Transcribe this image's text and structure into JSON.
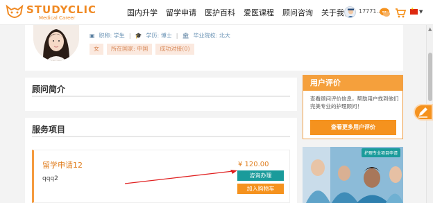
{
  "header": {
    "logo_text": "STUDYCLIC",
    "logo_sub": "Medical Career",
    "nav": [
      "国内升学",
      "留学申请",
      "医护百科",
      "爱医课程",
      "顾问咨询",
      "关于我们"
    ],
    "user_name": "17771..."
  },
  "profile": {
    "role_label": "职称: 学生",
    "degree_label": "学历: 博士",
    "school_label": "毕业院校: 北大",
    "tags": [
      "女",
      "所在国家: 中国",
      "成功对接(0)"
    ]
  },
  "intro": {
    "title": "顾问简介"
  },
  "services": {
    "title": "服务项目",
    "item": {
      "name": "留学申请12",
      "description": "qqq2",
      "price": "¥ 120.00",
      "consult_label": "咨询办理",
      "cart_label": "加入购物车"
    }
  },
  "reviews": {
    "title": "用户评价",
    "text": "查看顾问评价信息，帮助用户找到他们完美专业的护理顾问！",
    "button_label": "查看更多用户评价"
  },
  "ad": {
    "label": "护理专业项目申请"
  },
  "colors": {
    "brand_orange": "#f5921e",
    "teal": "#1a9b9b",
    "price_orange": "#e07e1f"
  }
}
